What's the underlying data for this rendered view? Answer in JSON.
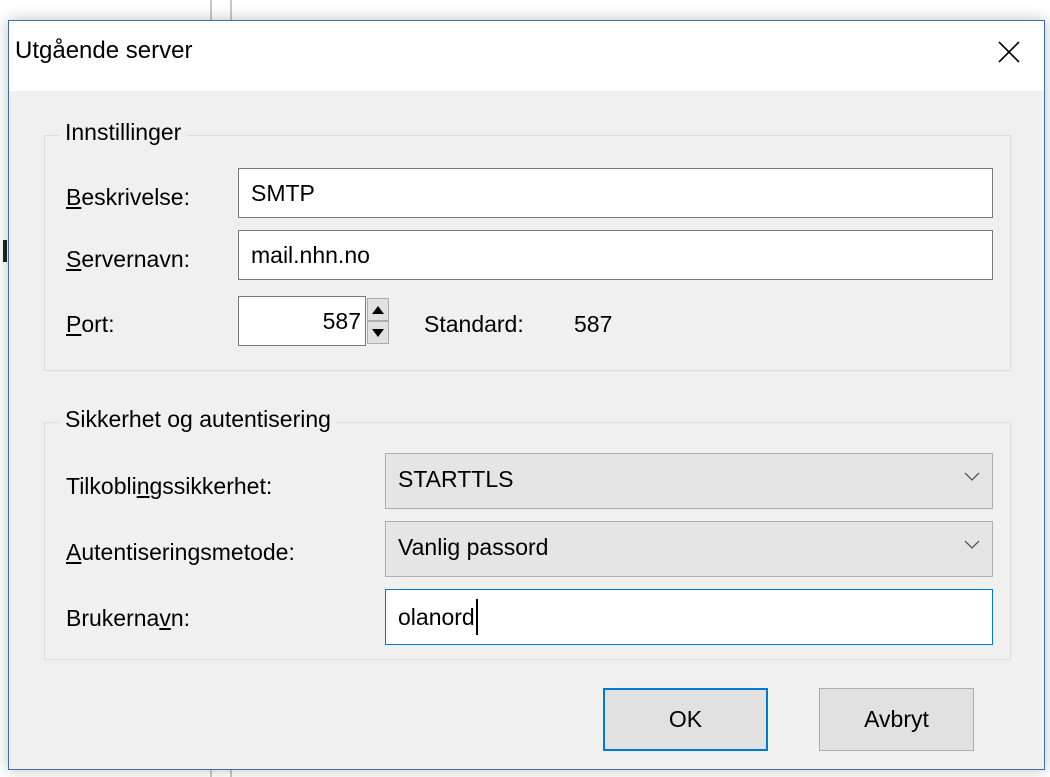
{
  "dialog": {
    "title": "Utgående server",
    "close_icon": "close-icon"
  },
  "settings": {
    "legend": "Innstillinger",
    "description": {
      "mnemonic": "B",
      "rest": "eskrivelse:",
      "value": "SMTP"
    },
    "server": {
      "mnemonic": "S",
      "rest": "ervernavn:",
      "value": "mail.nhn.no"
    },
    "port": {
      "mnemonic": "P",
      "rest": "ort:",
      "value": "587",
      "default_label": "Standard:",
      "default_value": "587"
    }
  },
  "security": {
    "legend": "Sikkerhet og autentisering",
    "connection": {
      "pre": "Tilkobli",
      "mnemonic": "n",
      "post": "gssikkerhet:",
      "value": "STARTTLS"
    },
    "auth": {
      "mnemonic": "A",
      "rest": "utentiseringsmetode:",
      "value": "Vanlig passord"
    },
    "username": {
      "pre": "Brukerna",
      "mnemonic": "v",
      "post": "n:",
      "value": "olanord"
    }
  },
  "buttons": {
    "ok": "OK",
    "cancel": "Avbryt"
  },
  "colors": {
    "focus_border": "#0078d7",
    "dialog_border": "#3c6ea8",
    "dialog_bg": "#f0f0f0"
  }
}
